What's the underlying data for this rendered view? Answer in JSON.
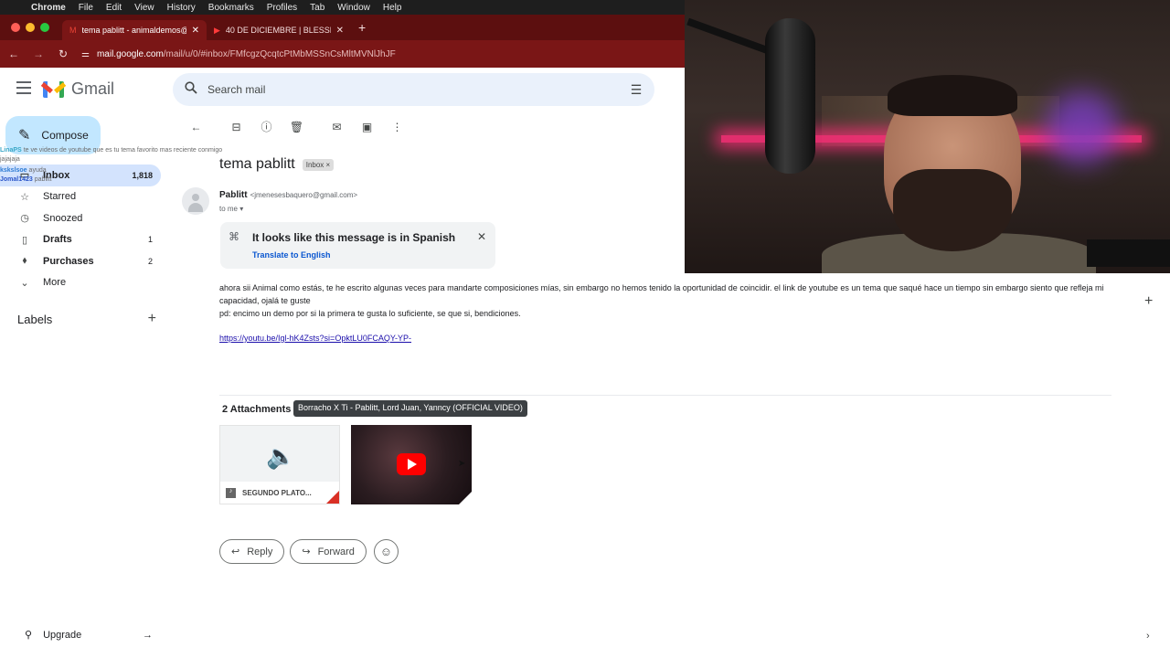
{
  "menubar": {
    "items": [
      "Chrome",
      "File",
      "Edit",
      "View",
      "History",
      "Bookmarks",
      "Profiles",
      "Tab",
      "Window",
      "Help"
    ]
  },
  "browser": {
    "tabs": [
      {
        "title": "tema pablitt - animaldemos@",
        "icon": "gmail-icon"
      },
      {
        "title": "40 DE DICIEMBRE | BLESSD",
        "icon": "youtube-icon"
      }
    ],
    "url_host": "mail.google.com",
    "url_path": "/mail/u/0/#inbox/FMfcgzQcqtcPtMbMSSnCsMltMVNlJhJF"
  },
  "gmail": {
    "brand": "Gmail",
    "search_placeholder": "Search mail",
    "compose_label": "Compose",
    "nav": [
      {
        "label": "Inbox",
        "count": "1,818",
        "icon": "inbox-icon"
      },
      {
        "label": "Starred",
        "count": "",
        "icon": "star-icon"
      },
      {
        "label": "Snoozed",
        "count": "",
        "icon": "clock-icon"
      },
      {
        "label": "Drafts",
        "count": "1",
        "icon": "file-icon"
      },
      {
        "label": "Purchases",
        "count": "2",
        "icon": "tag-icon"
      },
      {
        "label": "More",
        "count": "",
        "icon": "chevron-down-icon"
      }
    ],
    "labels_title": "Labels",
    "upgrade_label": "Upgrade"
  },
  "chat_overlay": [
    {
      "user": "LinaPS",
      "text": "te ve videos de youtube que es tu tema favorito mas reciente conmigo"
    },
    {
      "user": "",
      "text": "jajajaja"
    },
    {
      "user": "kskslsoe",
      "text": "ayuda"
    },
    {
      "user": "Jomal1423",
      "text": "pablitt"
    }
  ],
  "email": {
    "subject": "tema pablitt",
    "chip": "Inbox",
    "sender_name": "Pablitt",
    "sender_email": "<jmenesesbaquero@gmail.com>",
    "to": "to me",
    "translate_message": "It looks like this message is in Spanish",
    "translate_link": "Translate to English",
    "body_1": "ahora sii Animal como estás, te he escrito algunas veces para mandarte composiciones mías, sin embargo no hemos tenido la oportunidad de coincidir. el link de youtube es un tema que saqué hace un tiempo sin embargo siento que refleja mi capacidad, ojalá te guste",
    "body_2": "pd: encimo un demo por si la primera te gusta lo suficiente, se que si, bendiciones.",
    "link": "https://youtu.be/Igl-hK4Zsts?si=OpktLU0FCAQY-YP-",
    "attachments_title": "2 Attachments",
    "tooltip": "Borracho X Ti - Pablitt, Lord Juan, Yanncy (OFFICIAL VIDEO)",
    "attachment_1_name": "SEGUNDO PLATO...",
    "reply_label": "Reply",
    "forward_label": "Forward"
  }
}
